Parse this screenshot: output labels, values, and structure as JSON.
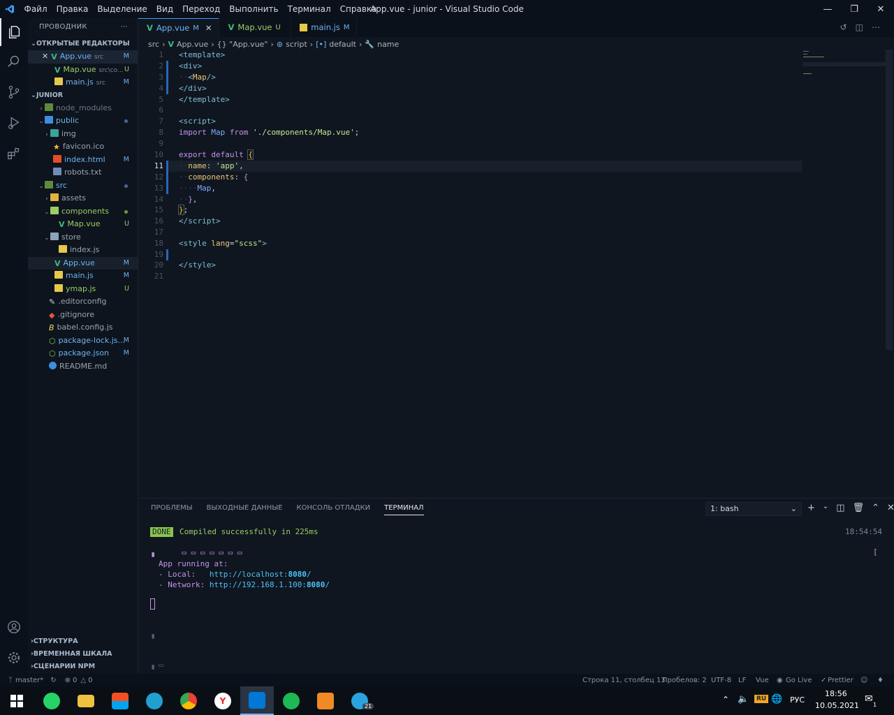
{
  "window": {
    "title": "App.vue - junior - Visual Studio Code",
    "menu": [
      "Файл",
      "Правка",
      "Выделение",
      "Вид",
      "Переход",
      "Выполнить",
      "Терминал",
      "Справка"
    ]
  },
  "sidebar": {
    "title": "ПРОВОДНИК",
    "open_editors_title": "ОТКРЫТЫЕ РЕДАКТОРЫ",
    "open_editors": [
      {
        "name": "App.vue",
        "hint": "src",
        "badge": "M"
      },
      {
        "name": "Map.vue",
        "hint": "src\\co...",
        "badge": "U"
      },
      {
        "name": "main.js",
        "hint": "src",
        "badge": "M"
      }
    ],
    "project_title": "JUNIOR",
    "tree": [
      {
        "name": "node_modules"
      },
      {
        "name": "public"
      },
      {
        "name": "img"
      },
      {
        "name": "favicon.ico"
      },
      {
        "name": "index.html",
        "badge": "M"
      },
      {
        "name": "robots.txt"
      },
      {
        "name": "src"
      },
      {
        "name": "assets"
      },
      {
        "name": "components"
      },
      {
        "name": "Map.vue",
        "badge": "U"
      },
      {
        "name": "store"
      },
      {
        "name": "index.js"
      },
      {
        "name": "App.vue",
        "badge": "M"
      },
      {
        "name": "main.js",
        "badge": "M"
      },
      {
        "name": "ymap.js",
        "badge": "U"
      },
      {
        "name": ".editorconfig"
      },
      {
        "name": ".gitignore"
      },
      {
        "name": "babel.config.js"
      },
      {
        "name": "package-lock.js...",
        "badge": "M"
      },
      {
        "name": "package.json",
        "badge": "M"
      },
      {
        "name": "README.md"
      }
    ],
    "bottom_sections": [
      "СТРУКТУРА",
      "ВРЕМЕННАЯ ШКАЛА",
      "СЦЕНАРИИ NPM"
    ]
  },
  "tabs": [
    {
      "name": "App.vue",
      "badge": "M"
    },
    {
      "name": "Map.vue",
      "badge": "U"
    },
    {
      "name": "main.js",
      "badge": "M"
    }
  ],
  "breadcrumb": [
    "src",
    "App.vue",
    "{} \"App.vue\"",
    "script",
    "default",
    "name"
  ],
  "editor": {
    "current_line": 11,
    "line_numbers": [
      "1",
      "2",
      "3",
      "4",
      "5",
      "6",
      "7",
      "8",
      "9",
      "10",
      "11",
      "12",
      "13",
      "14",
      "15",
      "16",
      "17",
      "18",
      "19",
      "20",
      "21"
    ]
  },
  "panel": {
    "tabs": [
      "ПРОБЛЕМЫ",
      "ВЫХОДНЫЕ ДАННЫЕ",
      "КОНСОЛЬ ОТЛАДКИ",
      "ТЕРМИНАЛ"
    ],
    "shell": "1: bash",
    "done_label": "DONE",
    "compiled": "Compiled successfully in 225ms",
    "time": "18:54:54",
    "running": "App running at:",
    "local_label": "- Local:   ",
    "local_url_a": "http://localhost:",
    "local_port": "8080",
    "local_url_b": "/",
    "network_label": "- Network: ",
    "network_url_a": "http://192.168.1.100:",
    "network_port": "8080",
    "network_url_b": "/"
  },
  "status": {
    "branch": "master*",
    "errors": "0",
    "warnings": "0",
    "position": "Строка 11, столбец 13",
    "spaces": "Пробелов: 2",
    "encoding": "UTF-8",
    "eol": "LF",
    "lang": "Vue",
    "golive": "Go Live",
    "prettier": "Prettier"
  },
  "taskbar": {
    "lang": "РУС",
    "time": "18:56",
    "date": "10.05.2021",
    "kbd": "RU",
    "telegram_badge": "21",
    "notif": "1"
  },
  "colors": {
    "accent": "#3b9cff",
    "modified": "#6fb3f2",
    "untracked": "#9ccc65",
    "done_bg": "#8bc34a"
  }
}
